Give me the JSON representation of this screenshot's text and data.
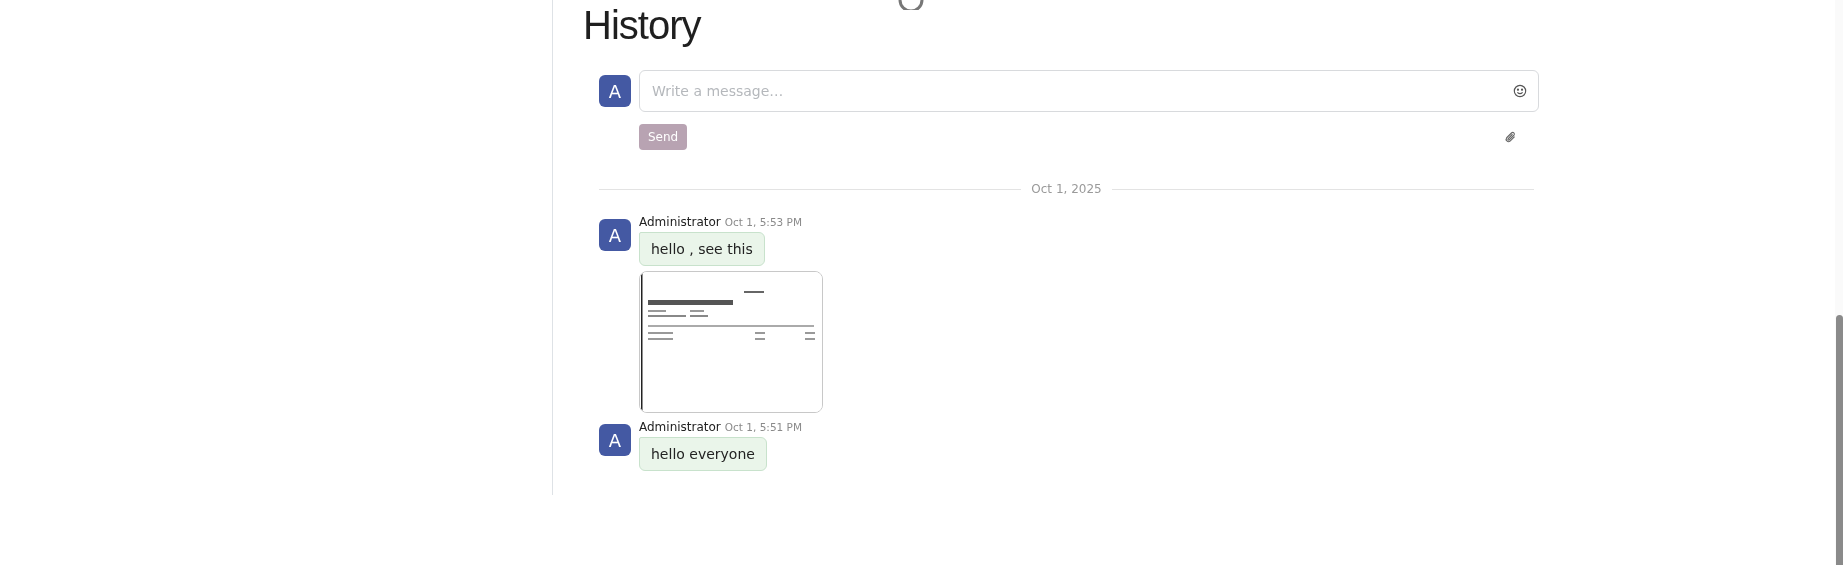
{
  "title": "History",
  "composer": {
    "avatar": "A",
    "placeholder": "Write a message…",
    "send_label": "Send"
  },
  "date_separator": "Oct 1, 2025",
  "messages": [
    {
      "avatar": "A",
      "author": "Administrator",
      "time": "Oct 1, 5:53 PM",
      "text": "hello , see this"
    },
    {
      "avatar": "A",
      "author": "Administrator",
      "time": "Oct 1, 5:51 PM",
      "text": "hello everyone"
    }
  ]
}
